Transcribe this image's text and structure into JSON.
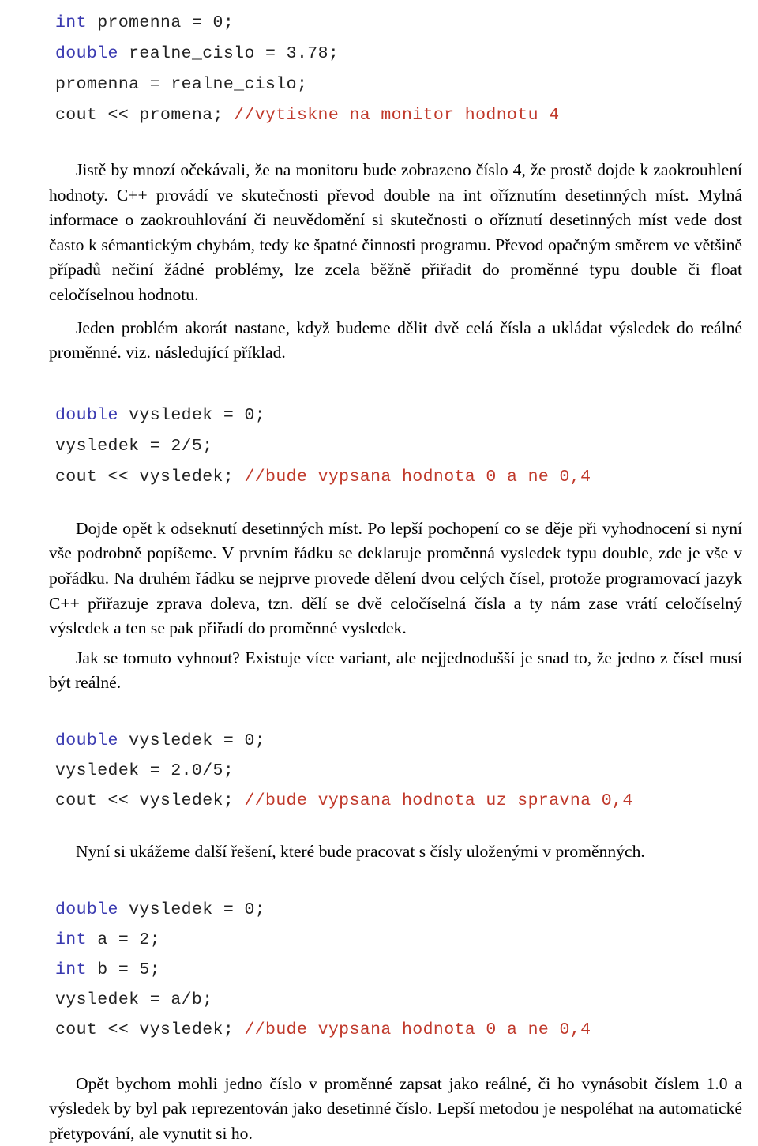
{
  "document": {
    "language": "cs",
    "title": "C++ — převod a přetypování číselných typů",
    "colors": {
      "text": "#000000",
      "code_plain": "#222222",
      "code_keyword": "#3a3ab0",
      "code_comment": "#c0392b",
      "background": "#ffffff"
    }
  },
  "blocks": [
    {
      "id": "code1",
      "type": "code",
      "lines": [
        {
          "keyword": "int",
          "plain": " promenna = 0;",
          "comment": ""
        },
        {
          "keyword": "double",
          "plain": " realne_cislo = 3.78;",
          "comment": ""
        },
        {
          "keyword": "",
          "plain": "promenna = realne_cislo;",
          "comment": ""
        },
        {
          "keyword": "",
          "plain": "cout << promena; ",
          "comment": "//vytiskne na monitor hodnotu 4"
        }
      ]
    },
    {
      "id": "para1",
      "type": "paragraph",
      "text": "Jistě  by mnozí očekávali, že na monitoru bude zobrazeno číslo 4, že prostě dojde k zaokrouhlení hodnoty. C++ provádí ve skutečnosti převod double na int oříznutím desetinných míst. Mylná informace o zaokrouhlování či neuvědomění si skutečnosti o oříznutí desetinných míst vede dost často k sémantickým chybám, tedy ke špatné činnosti programu.  Převod opačným směrem  ve většině případů nečiní žádné problémy, lze zcela běžně přiřadit do proměnné typu double či float celočíselnou hodnotu."
    },
    {
      "id": "para2",
      "type": "paragraph",
      "text": "Jeden problém akorát nastane, když budeme dělit dvě celá čísla a ukládat výsledek do reálné proměnné. viz. následující příklad."
    },
    {
      "id": "code2",
      "type": "code",
      "lines": [
        {
          "keyword": "double",
          "plain": " vysledek = 0;",
          "comment": ""
        },
        {
          "keyword": "",
          "plain": "vysledek = 2/5;",
          "comment": ""
        },
        {
          "keyword": "",
          "plain": "cout << vysledek; ",
          "comment": "//bude vypsana hodnota 0 a ne 0,4"
        }
      ]
    },
    {
      "id": "para3",
      "type": "paragraph",
      "text": "Dojde opět k odseknutí desetinných míst.  Po lepší pochopení co se děje při vyhodnocení si nyní vše podrobně popíšeme. V prvním řádku se deklaruje proměnná vysledek typu double, zde je vše v pořádku. Na druhém řádku se nejprve provede dělení dvou celých čísel, protože programovací jazyk C++ přiřazuje zprava doleva, tzn. dělí se dvě celočíselná čísla a ty nám zase vrátí celočíselný výsledek a ten se pak přiřadí do proměnné vysledek."
    },
    {
      "id": "para4",
      "type": "paragraph",
      "text": "Jak se tomuto vyhnout?  Existuje více variant, ale nejjednodušší je snad to, že jedno z čísel musí být reálné."
    },
    {
      "id": "code3",
      "type": "code",
      "lines": [
        {
          "keyword": "double",
          "plain": " vysledek = 0;",
          "comment": ""
        },
        {
          "keyword": "",
          "plain": "vysledek = 2.0/5;",
          "comment": ""
        },
        {
          "keyword": "",
          "plain": "cout << vysledek; ",
          "comment": "//bude vypsana hodnota uz spravna 0,4"
        }
      ]
    },
    {
      "id": "para5",
      "type": "paragraph",
      "text": "Nyní si ukážeme další řešení, které bude pracovat s čísly uloženými v proměnných."
    },
    {
      "id": "code4",
      "type": "code",
      "lines": [
        {
          "keyword": "double",
          "plain": " vysledek = 0;",
          "comment": ""
        },
        {
          "keyword": "int",
          "plain": " a = 2;",
          "comment": ""
        },
        {
          "keyword": "int",
          "plain": " b = 5;",
          "comment": ""
        },
        {
          "keyword": "",
          "plain": "vysledek = a/b;",
          "comment": ""
        },
        {
          "keyword": "",
          "plain": "cout << vysledek; ",
          "comment": "//bude vypsana hodnota 0 a ne 0,4"
        }
      ]
    },
    {
      "id": "para6",
      "type": "paragraph",
      "text": "Opět bychom mohli jedno číslo v proměnné zapsat jako reálné, či ho vynásobit číslem 1.0 a výsledek by byl pak reprezentován jako desetinné číslo. Lepší metodou je nespoléhat na automatické přetypování, ale vynutit si ho."
    }
  ]
}
